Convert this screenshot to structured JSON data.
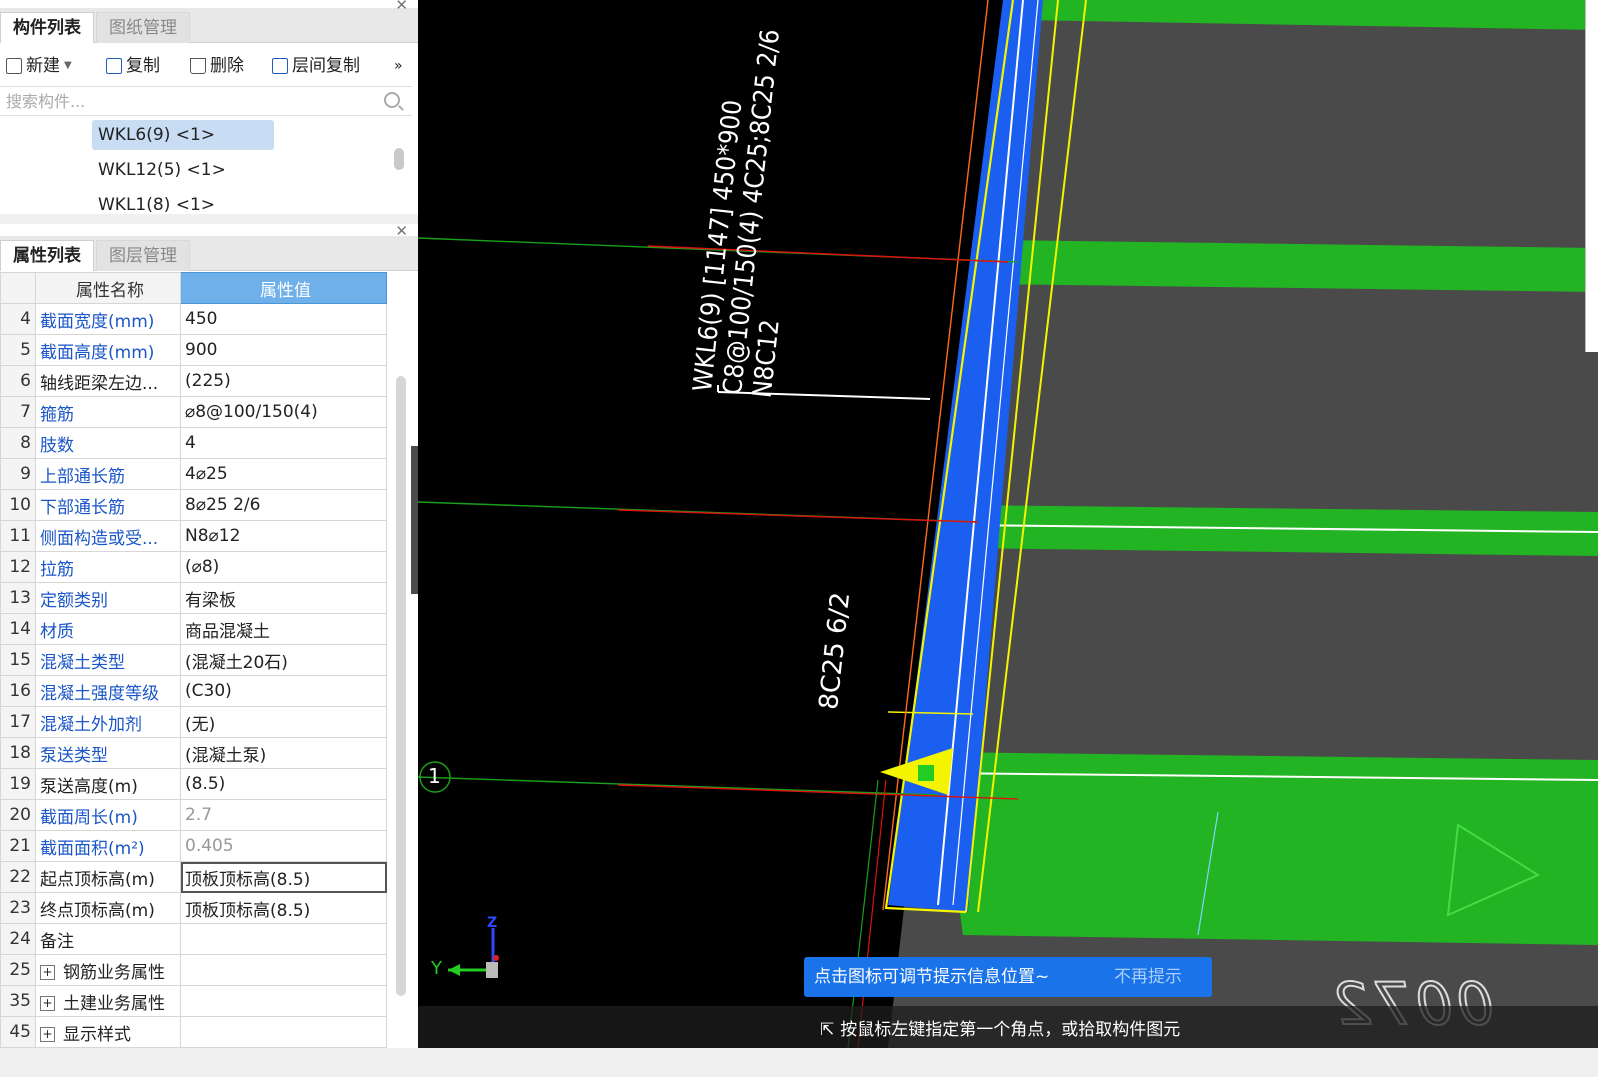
{
  "component_panel": {
    "tabs": [
      "构件列表",
      "图纸管理"
    ],
    "toolbar": {
      "new": "新建",
      "copy": "复制",
      "delete": "删除",
      "floor_copy": "层间复制",
      "more": "»"
    },
    "search_placeholder": "搜索构件...",
    "items": [
      "WKL6(9)  <1>",
      "WKL12(5)  <1>",
      "WKL1(8)  <1>"
    ]
  },
  "property_panel": {
    "tabs": [
      "属性列表",
      "图层管理"
    ],
    "header": {
      "name": "属性名称",
      "value": "属性值"
    },
    "rows": [
      {
        "num": "4",
        "name": "截面宽度(mm)",
        "value": "450",
        "blue": true
      },
      {
        "num": "5",
        "name": "截面高度(mm)",
        "value": "900",
        "blue": true
      },
      {
        "num": "6",
        "name": "轴线距梁左边...",
        "value": "(225)",
        "blue": false
      },
      {
        "num": "7",
        "name": "箍筋",
        "value": "⌀8@100/150(4)",
        "blue": true
      },
      {
        "num": "8",
        "name": "肢数",
        "value": "4",
        "blue": true
      },
      {
        "num": "9",
        "name": "上部通长筋",
        "value": "4⌀25",
        "blue": true
      },
      {
        "num": "10",
        "name": "下部通长筋",
        "value": "8⌀25 2/6",
        "blue": true
      },
      {
        "num": "11",
        "name": "侧面构造或受...",
        "value": "N8⌀12",
        "blue": true
      },
      {
        "num": "12",
        "name": "拉筋",
        "value": "(⌀8)",
        "blue": true
      },
      {
        "num": "13",
        "name": "定额类别",
        "value": "有梁板",
        "blue": true
      },
      {
        "num": "14",
        "name": "材质",
        "value": "商品混凝土",
        "blue": true
      },
      {
        "num": "15",
        "name": "混凝土类型",
        "value": "(混凝土20石)",
        "blue": true
      },
      {
        "num": "16",
        "name": "混凝土强度等级",
        "value": "(C30)",
        "blue": true
      },
      {
        "num": "17",
        "name": "混凝土外加剂",
        "value": "(无)",
        "blue": true
      },
      {
        "num": "18",
        "name": "泵送类型",
        "value": "(混凝土泵)",
        "blue": true
      },
      {
        "num": "19",
        "name": "泵送高度(m)",
        "value": "(8.5)",
        "blue": false
      },
      {
        "num": "20",
        "name": "截面周长(m)",
        "value": "2.7",
        "blue": true,
        "gray": true
      },
      {
        "num": "21",
        "name": "截面面积(m²)",
        "value": "0.405",
        "blue": true,
        "gray": true
      },
      {
        "num": "22",
        "name": "起点顶标高(m)",
        "value": "顶板顶标高(8.5)",
        "blue": false,
        "selected": true
      },
      {
        "num": "23",
        "name": "终点顶标高(m)",
        "value": "顶板顶标高(8.5)",
        "blue": false
      },
      {
        "num": "24",
        "name": "备注",
        "value": "",
        "blue": false
      },
      {
        "num": "25",
        "name": "钢筋业务属性",
        "value": "",
        "blue": false,
        "group": true
      },
      {
        "num": "35",
        "name": "土建业务属性",
        "value": "",
        "blue": false,
        "group": true
      },
      {
        "num": "45",
        "name": "显示样式",
        "value": "",
        "blue": false,
        "group": true
      }
    ]
  },
  "canvas": {
    "annotation_lines": [
      "WKL6(9) [1147] 450*900",
      "C8@100/150(4) 4C25;8C25 2/6",
      "N8C12"
    ],
    "bottom_label": "8C25 6/2",
    "axis_label": "1",
    "corner_number": "0072",
    "axes": {
      "y": "Y",
      "z": "Z"
    }
  },
  "tip": {
    "text": "点击图标可调节提示信息位置~",
    "dismiss": "不再提示"
  },
  "status": "按鼠标左键指定第一个角点，或拾取构件图元",
  "colors": {
    "beam_blue": "#1a5ff0",
    "slab_green": "#22b422",
    "slab_gray": "#4a4a4a",
    "accent": "#1a73e8"
  }
}
